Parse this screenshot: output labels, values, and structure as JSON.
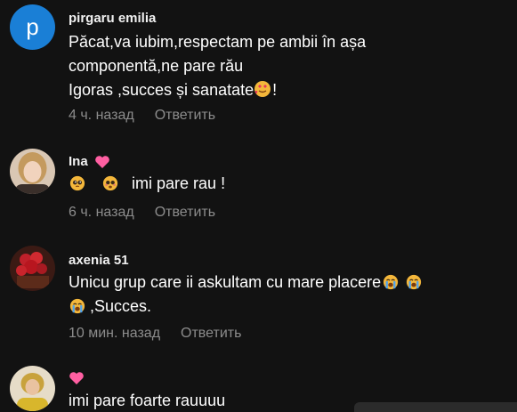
{
  "comments": [
    {
      "author": "pirgaru emilia",
      "avatar_letter": "p",
      "lines": [
        "Păcat,va iubim,respectam pe ambii în așa",
        "componentă,ne pare rău",
        "Igoras ,succes și sanatate"
      ],
      "line3_suffix": "!",
      "time": "4 ч. назад",
      "reply_label": "Ответить"
    },
    {
      "author": "Ina",
      "text": "imi pare rau !",
      "time": "6 ч. назад",
      "reply_label": "Ответить"
    },
    {
      "author": "axenia 51",
      "lines": [
        "Unicu grup care ii askultam cu mare placere",
        ",Succes."
      ],
      "time": "10 мин. назад",
      "reply_label": "Ответить"
    },
    {
      "author": "",
      "text": "imi pare foarte rauuuu"
    }
  ],
  "colors": {
    "background": "#121212",
    "meta_text": "#8c8c8c",
    "avatar_blue": "#1a7fd6",
    "heart_pink": "#ff5fa2"
  },
  "icons": {
    "heart": "pink-heart-icon",
    "face_hearts": "smiling-face-with-hearts-icon",
    "pleading": "pleading-face-icon",
    "crying": "loudly-crying-face-icon"
  }
}
